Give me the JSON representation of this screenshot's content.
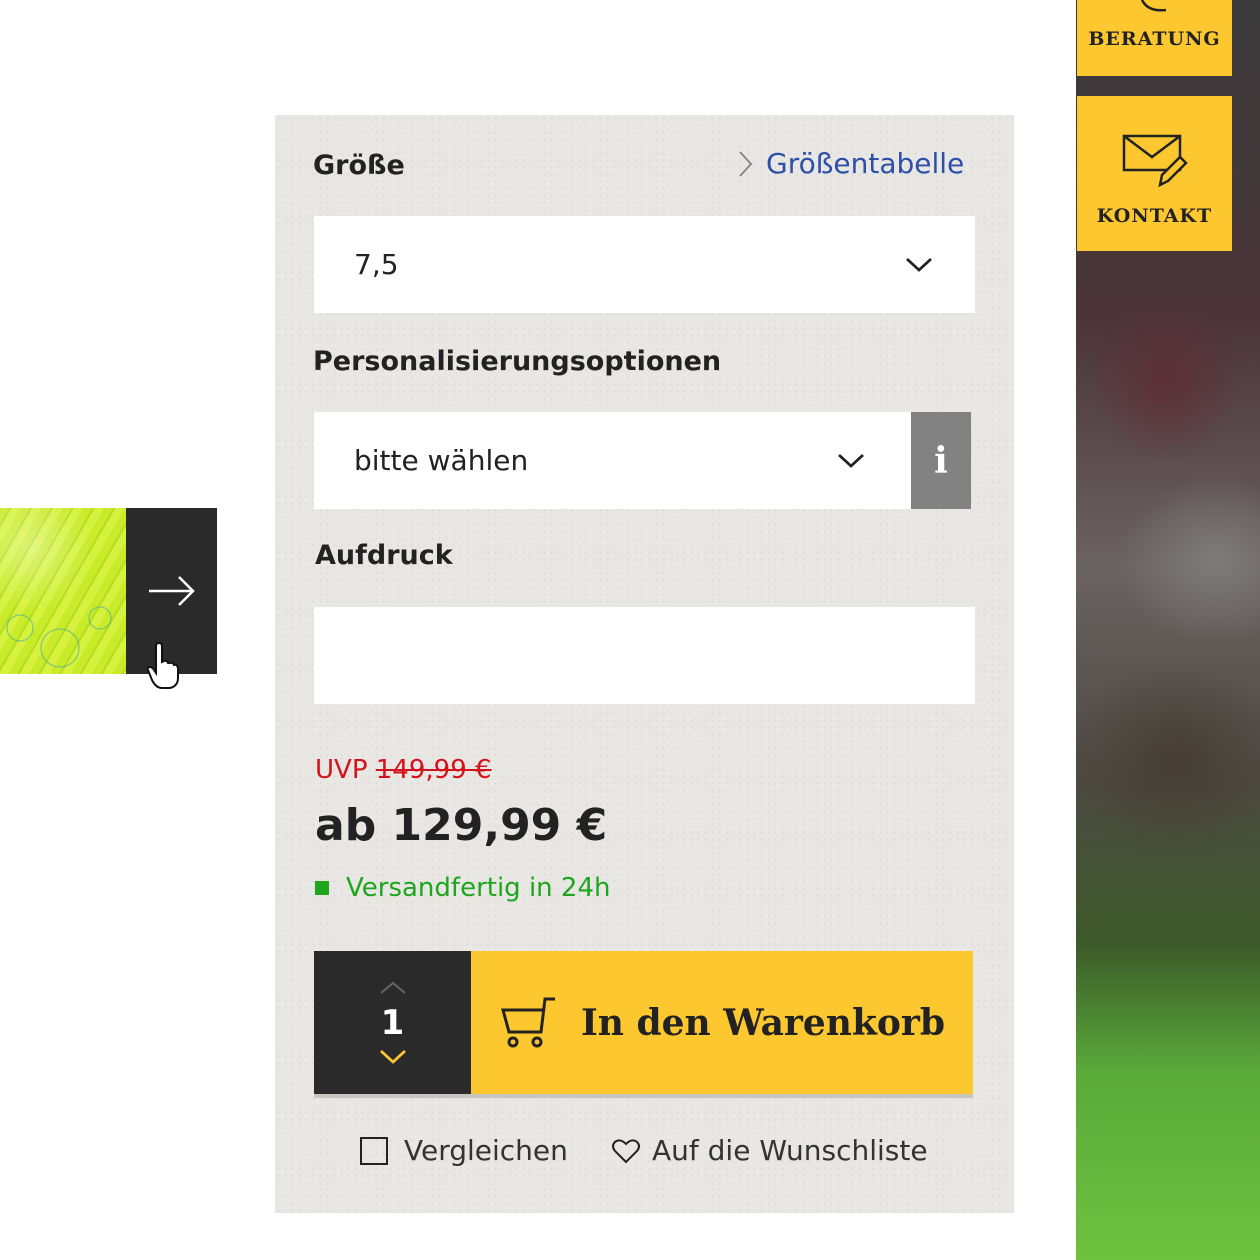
{
  "side_buttons": {
    "beratung": {
      "label": "BERATUNG",
      "icon": "phone-icon"
    },
    "kontakt": {
      "label": "KONTAKT",
      "icon": "mail-icon"
    }
  },
  "product_form": {
    "size_label": "Größe",
    "size_table_link": "Größentabelle",
    "size_value": "7,5",
    "personalization_label": "Personalisierungsoptionen",
    "personalization_value": "bitte wählen",
    "info_label": "i",
    "imprint_label": "Aufdruck",
    "imprint_value": ""
  },
  "pricing": {
    "uvp_prefix": "UVP",
    "uvp_price": "149,99 €",
    "price": "ab 129,99 €",
    "availability": "Versandfertig in 24h"
  },
  "cart": {
    "quantity": "1",
    "add_to_cart": "In den Warenkorb"
  },
  "actions": {
    "compare": "Vergleichen",
    "wishlist": "Auf die Wunschliste"
  },
  "colors": {
    "accent_yellow": "#fdc82f",
    "dark": "#2a2a2a",
    "link_blue": "#2e4fa8",
    "uvp_red": "#d4121b",
    "stock_green": "#1ea51e"
  }
}
